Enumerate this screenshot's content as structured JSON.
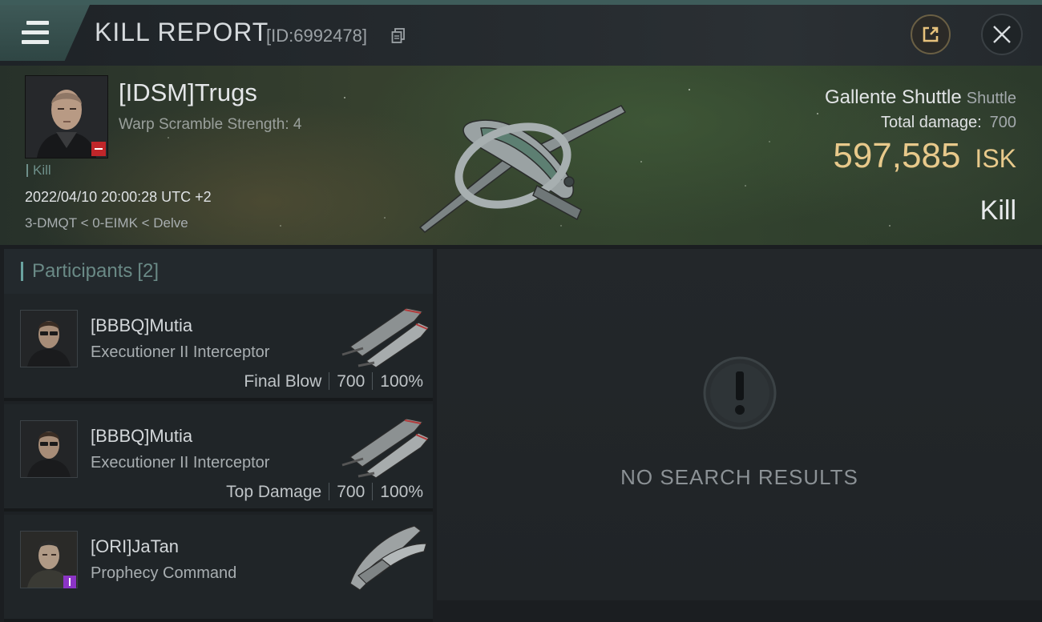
{
  "header": {
    "title": "KILL REPORT",
    "report_id": "[ID:6992478]",
    "icons": {
      "menu": "menu-icon",
      "copy": "copy-icon",
      "share": "share-icon",
      "close": "close-icon"
    }
  },
  "victim": {
    "name": "[IDSM]Trugs",
    "subtitle": "Warp Scramble Strength: 4",
    "tag": "Kill",
    "datetime": "2022/04/10 20:00:28 UTC +2",
    "location": "3-DMQT < 0-EIMK < Delve",
    "ship_name": "Gallente Shuttle",
    "ship_class": "Shuttle",
    "total_damage_label": "Total damage:",
    "total_damage": "700",
    "isk_value": "597,585",
    "isk_unit": "ISK",
    "result": "Kill",
    "corp_badge_color": "#c0262a"
  },
  "participants": {
    "title": "Participants",
    "count": "[2]",
    "rows": [
      {
        "name": "[BBBQ]Mutia",
        "ship": "Executioner II Interceptor",
        "role": "Final Blow",
        "damage": "700",
        "percent": "100%"
      },
      {
        "name": "[BBBQ]Mutia",
        "ship": "Executioner II Interceptor",
        "role": "Top Damage",
        "damage": "700",
        "percent": "100%"
      },
      {
        "name": "[ORI]JaTan",
        "ship": "Prophecy Command",
        "role": "",
        "damage": "",
        "percent": ""
      }
    ]
  },
  "results": {
    "empty_text": "NO SEARCH RESULTS",
    "icon": "exclamation-icon"
  },
  "colors": {
    "accent_teal": "#3e5957",
    "isk_gold": "#e8c98b",
    "alliance_badge": "#8b34c5"
  }
}
